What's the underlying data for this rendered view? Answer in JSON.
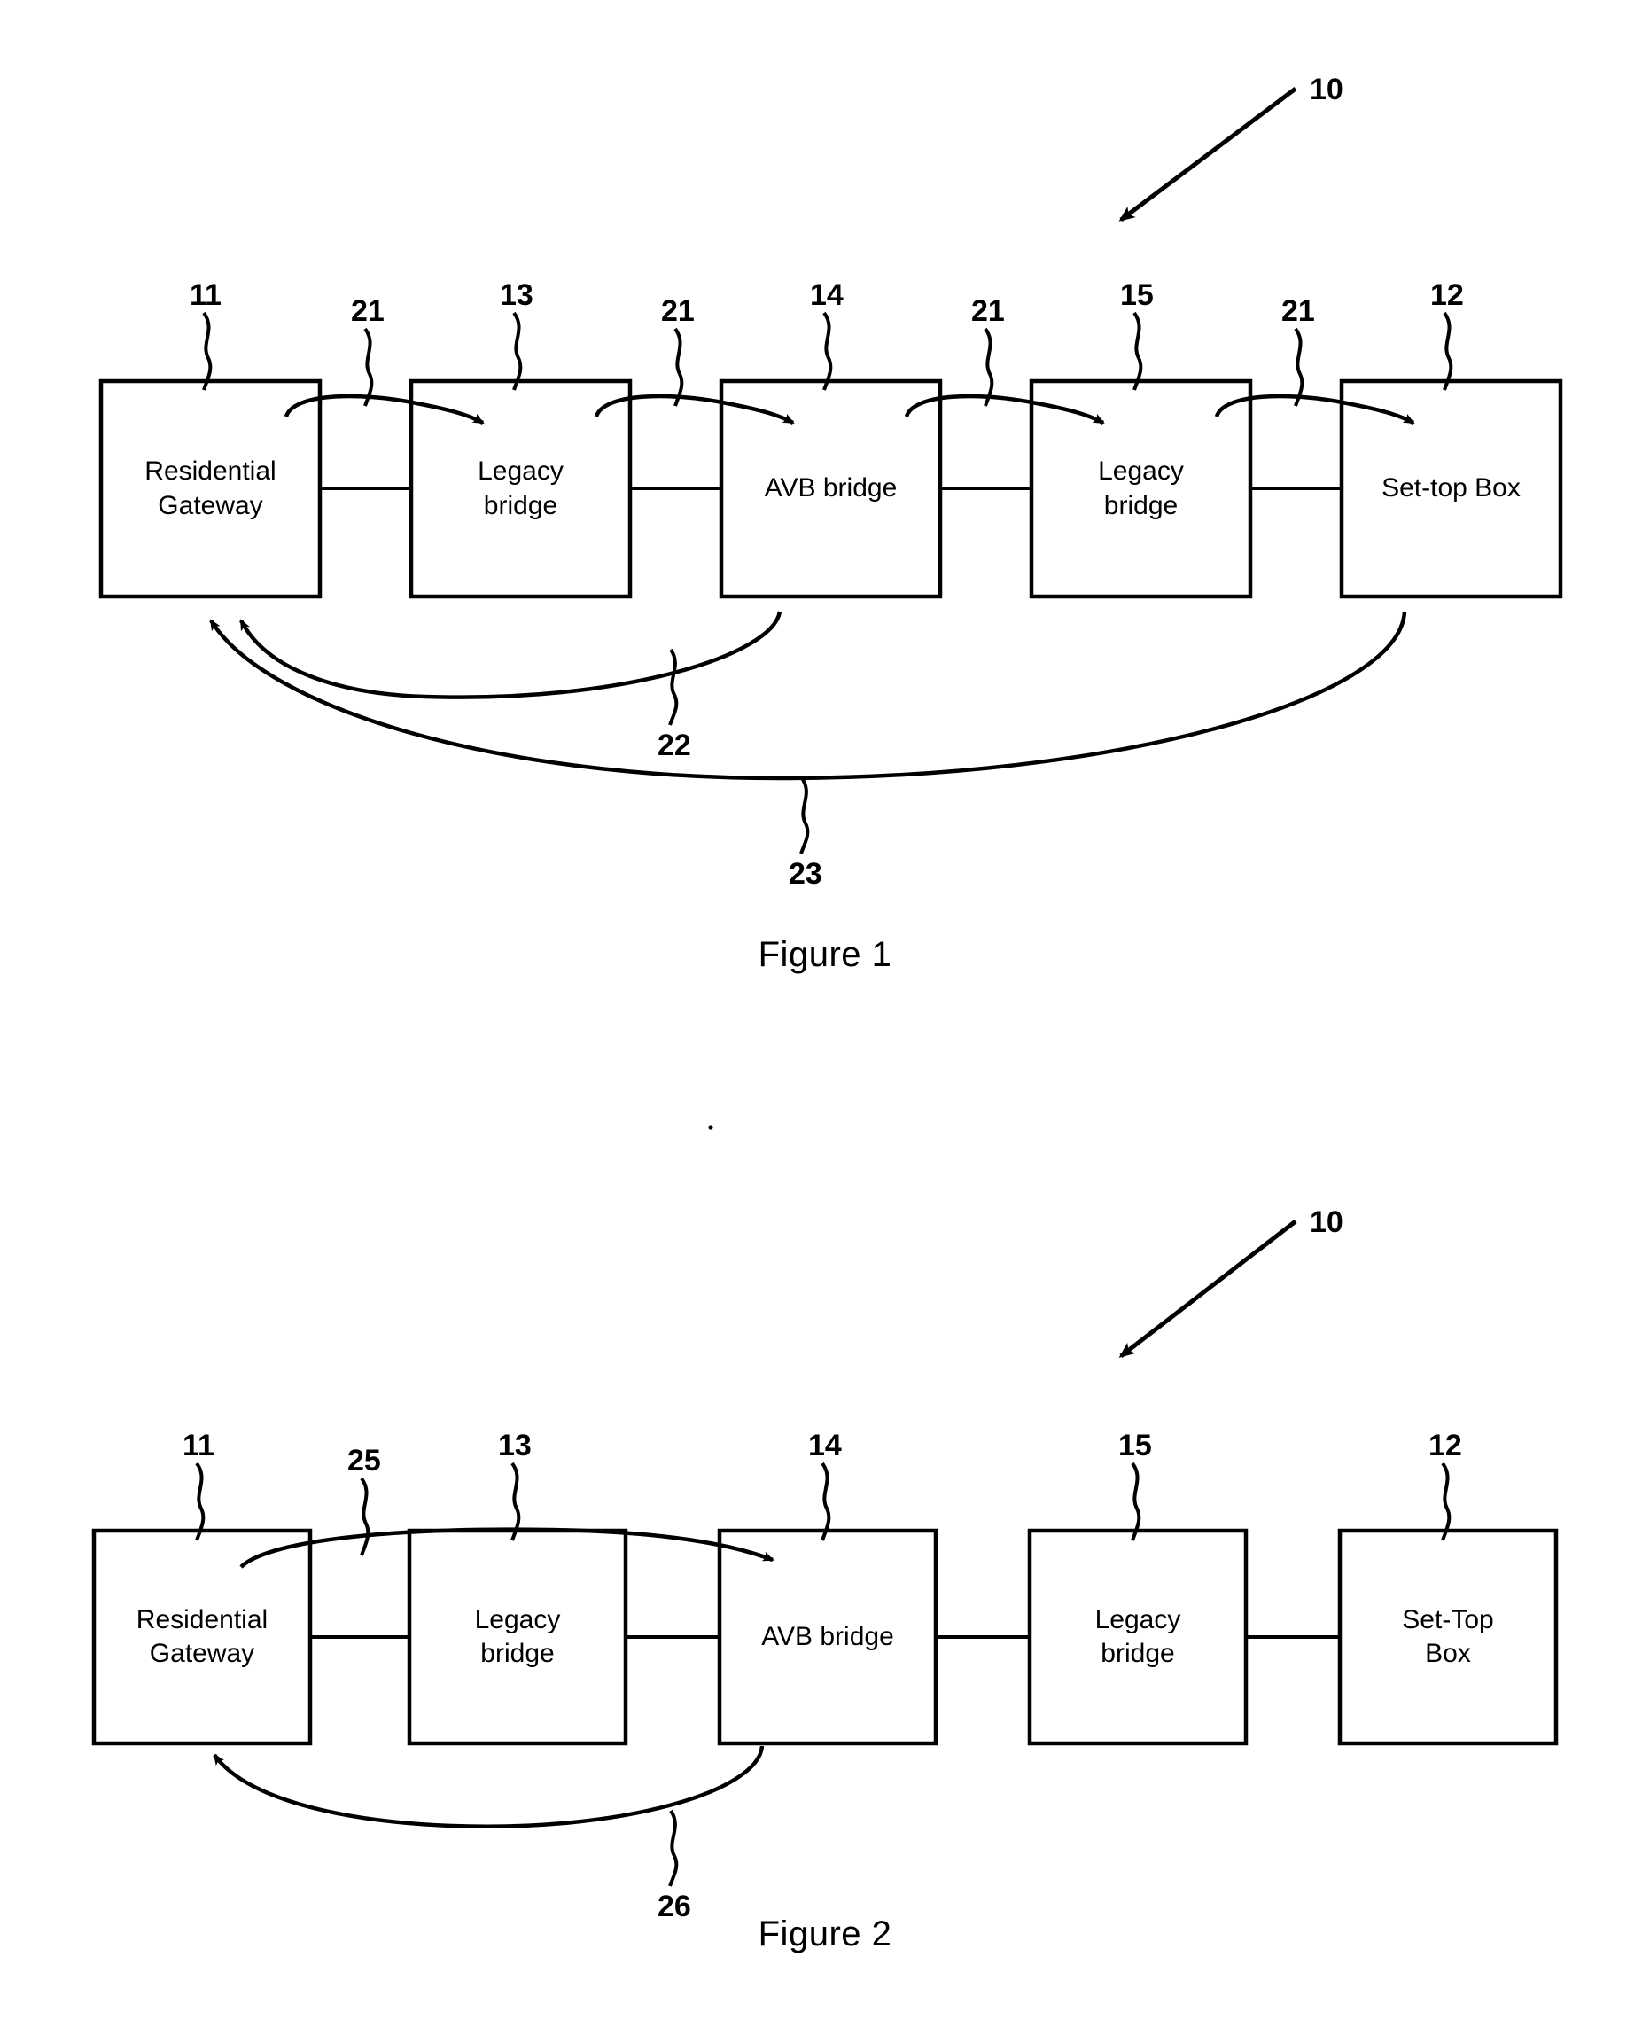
{
  "page": {
    "title": "Patent drawing sheet",
    "background": "#ffffff",
    "ink": "#000000"
  },
  "figures": [
    {
      "id": "figure-1",
      "caption": "Figure 1",
      "system_ref": "10",
      "nodes": [
        {
          "ref": "11",
          "label": "Residential\nGateway",
          "line1": "Residential",
          "line2": "Gateway"
        },
        {
          "ref": "13",
          "label": "Legacy\nbridge",
          "line1": "Legacy",
          "line2": "bridge"
        },
        {
          "ref": "14",
          "label": "AVB bridge",
          "line1": "AVB bridge",
          "line2": ""
        },
        {
          "ref": "15",
          "label": "Legacy\nbridge",
          "line1": "Legacy",
          "line2": "bridge"
        },
        {
          "ref": "12",
          "label": "Set-top Box",
          "line1": "Set-top Box",
          "line2": ""
        }
      ],
      "hop_refs": [
        "21",
        "21",
        "21",
        "21"
      ],
      "return_paths": [
        {
          "ref": "22",
          "from": "14",
          "to": "11"
        },
        {
          "ref": "23",
          "from": "12",
          "to": "11"
        }
      ]
    },
    {
      "id": "figure-2",
      "caption": "Figure 2",
      "system_ref": "10",
      "nodes": [
        {
          "ref": "11",
          "label": "Residential\nGateway",
          "line1": "Residential",
          "line2": "Gateway"
        },
        {
          "ref": "13",
          "label": "Legacy\nbridge",
          "line1": "Legacy",
          "line2": "bridge"
        },
        {
          "ref": "14",
          "label": "AVB bridge",
          "line1": "AVB bridge",
          "line2": ""
        },
        {
          "ref": "15",
          "label": "Legacy\nbridge",
          "line1": "Legacy",
          "line2": "bridge"
        },
        {
          "ref": "12",
          "label": "Set-Top\nBox",
          "line1": "Set-Top",
          "line2": "Box"
        }
      ],
      "hop_refs": [
        "25"
      ],
      "return_paths": [
        {
          "ref": "26",
          "from": "14",
          "to": "11"
        }
      ]
    }
  ]
}
